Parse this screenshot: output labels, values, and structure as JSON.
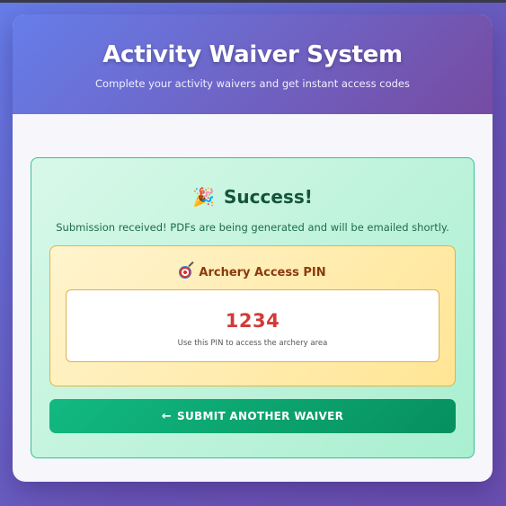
{
  "header": {
    "title": "Activity Waiver System",
    "subtitle": "Complete your activity waivers and get instant access codes"
  },
  "success": {
    "icon": "party-popper-icon",
    "title": "Success!",
    "message": "Submission received! PDFs are being generated and will be emailed shortly."
  },
  "pin": {
    "icon": "target-icon",
    "title": "Archery Access PIN",
    "value": "1234",
    "note": "Use this PIN to access the archery area"
  },
  "actions": {
    "submit_another_label": "SUBMIT ANOTHER WAIVER",
    "arrow_glyph": "←"
  },
  "colors": {
    "header_start": "#667eea",
    "header_end": "#764ba2",
    "success_text": "#14543c",
    "pin_value": "#d33a3a",
    "button": "#10b981"
  }
}
